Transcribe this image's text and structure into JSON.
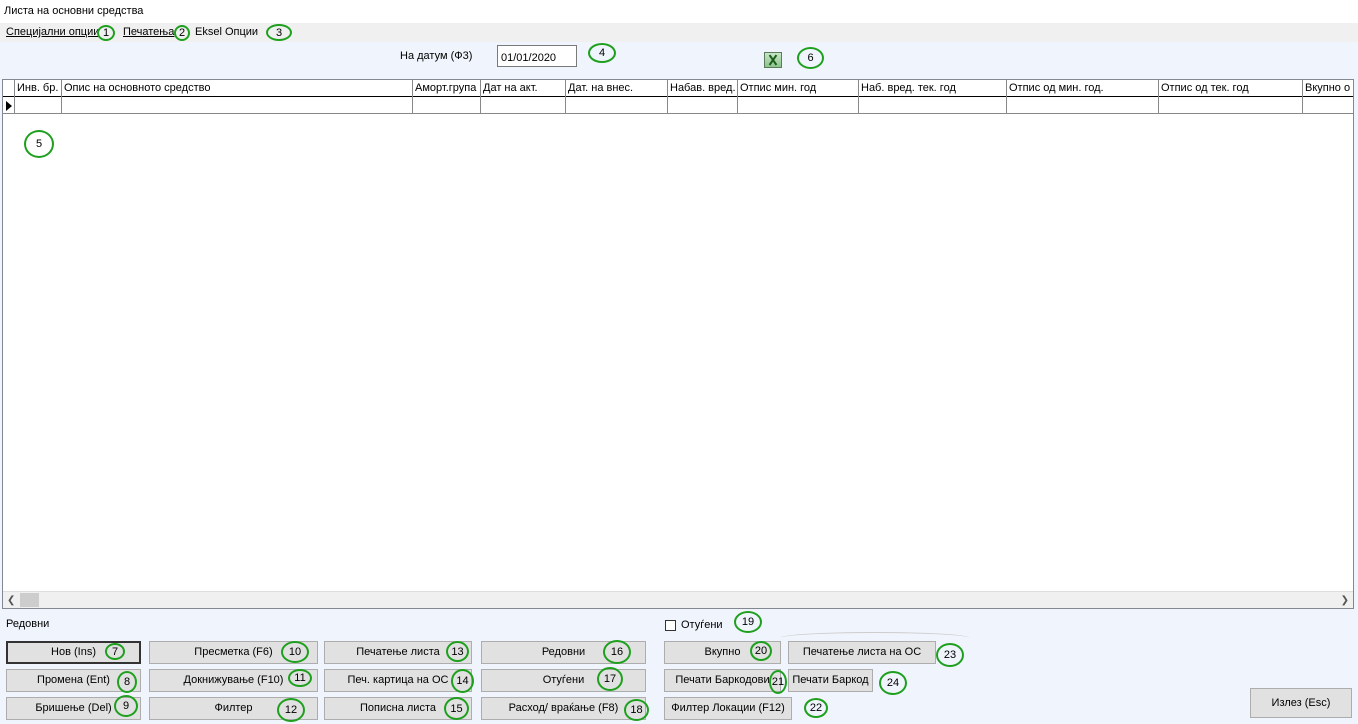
{
  "window": {
    "title": "Листа на основни средства"
  },
  "menu": [
    {
      "label": "Специјални опции"
    },
    {
      "label": "Печатења"
    },
    {
      "label": "Eksel Опции"
    }
  ],
  "date_filter": {
    "label": "На датум (Ф3)",
    "value": "01/01/2020"
  },
  "excel": {
    "icon": "excel-icon"
  },
  "grid": {
    "columns": [
      "Инв. бр.",
      "Опис на основното средство",
      "Аморт.група",
      "Дат на акт.",
      "Дат. на внес.",
      "Набав. вред.",
      "Отпис мин. год",
      "Наб. вред. тек. год",
      "Отпис од мин. год.",
      "Отпис од тек. год",
      "Вкупно о"
    ]
  },
  "status": {
    "label": "Редовни"
  },
  "checkbox": {
    "label": "Отуѓени",
    "checked": false
  },
  "buttons": {
    "nov": "Нов (Ins)",
    "promena": "Промена (Ent)",
    "brisenje": "Бришење (Del)",
    "presmetka": "Пресметка (F6)",
    "doknizuvanje": "Докнижување (F10)",
    "filter": "Филтер",
    "pecatenje_lista": "Печатење листа",
    "pec_kartica": "Печ. картица на ОС",
    "popisna_lista": "Пописна листа",
    "redovni": "Редовни",
    "otugeni": "Отуѓени",
    "rashod": "Расход/ враќање (F8)",
    "vkupno": "Вкупно",
    "pecati_barkodovi": "Печати Баркодови",
    "filter_lokacii": "Филтер Локации (F12)",
    "pecatenje_lista_os": "Печатење листа на ОС",
    "pecati_barkod": "Печати Баркод",
    "izlez": "Излез (Esc)"
  },
  "annotations": [
    "1",
    "2",
    "3",
    "4",
    "5",
    "6",
    "7",
    "8",
    "9",
    "10",
    "11",
    "12",
    "13",
    "14",
    "15",
    "16",
    "17",
    "18",
    "19",
    "20",
    "21",
    "22",
    "23",
    "24"
  ],
  "colors": {
    "annotation_ring": "#1ea01e",
    "background": "#f0f4fc",
    "button": "#e1e1e1"
  }
}
